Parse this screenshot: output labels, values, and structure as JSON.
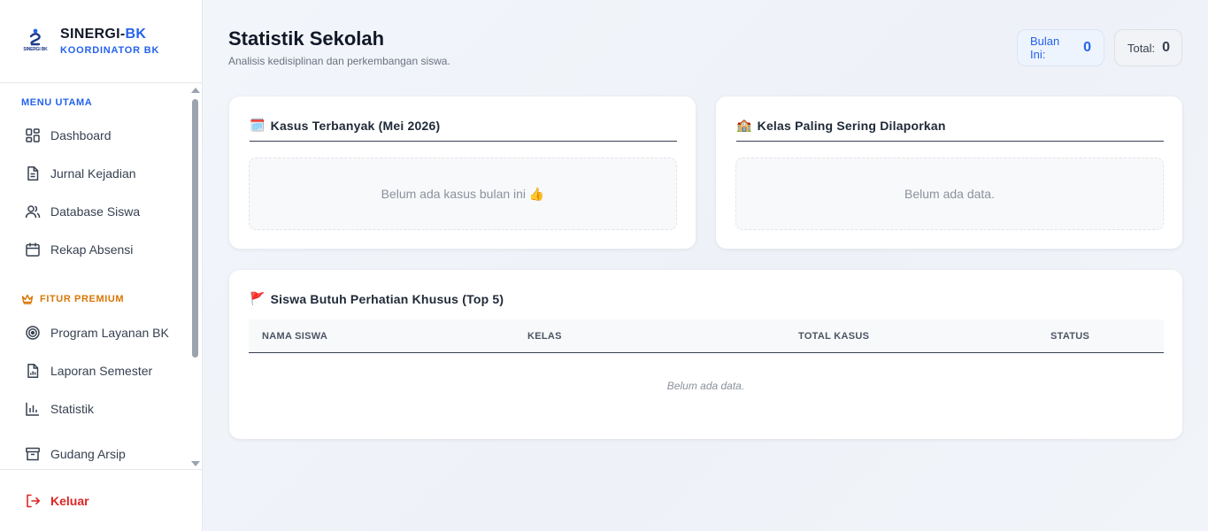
{
  "brand": {
    "name_main": "SINERGI-",
    "name_accent": "BK",
    "role": "KOORDINATOR BK",
    "logo_text": "SINERGI BK"
  },
  "sidebar": {
    "section_main": "MENU UTAMA",
    "main_items": [
      {
        "label": "Dashboard",
        "icon": "grid-icon"
      },
      {
        "label": "Jurnal Kejadian",
        "icon": "document-icon"
      },
      {
        "label": "Database Siswa",
        "icon": "users-icon"
      },
      {
        "label": "Rekap Absensi",
        "icon": "calendar-icon"
      }
    ],
    "section_premium": "FITUR PREMIUM",
    "premium_items": [
      {
        "label": "Program Layanan BK",
        "icon": "target-icon"
      },
      {
        "label": "Laporan Semester",
        "icon": "report-icon"
      },
      {
        "label": "Statistik",
        "icon": "bar-chart-icon"
      },
      {
        "label": "Gudang Arsip",
        "icon": "archive-icon"
      }
    ],
    "logout": "Keluar"
  },
  "header": {
    "title": "Statistik Sekolah",
    "subtitle": "Analisis kedisiplinan dan perkembangan siswa.",
    "month_label": "Bulan Ini:",
    "month_value": "0",
    "total_label": "Total:",
    "total_value": "0"
  },
  "cards": {
    "top_cases": {
      "emoji": "🗓️",
      "title": "Kasus Terbanyak (Mei 2026)",
      "empty": "Belum ada kasus bulan ini 👍"
    },
    "top_classes": {
      "emoji": "🏫",
      "title": "Kelas Paling Sering Dilaporkan",
      "empty": "Belum ada data."
    },
    "attention": {
      "emoji": "🚩",
      "title": "Siswa Butuh Perhatian Khusus (Top 5)",
      "columns": [
        "NAMA SISWA",
        "KELAS",
        "TOTAL KASUS",
        "STATUS"
      ],
      "empty": "Belum ada data."
    }
  },
  "colors": {
    "accent": "#2563eb",
    "premium": "#d97706",
    "danger": "#dc2626"
  }
}
